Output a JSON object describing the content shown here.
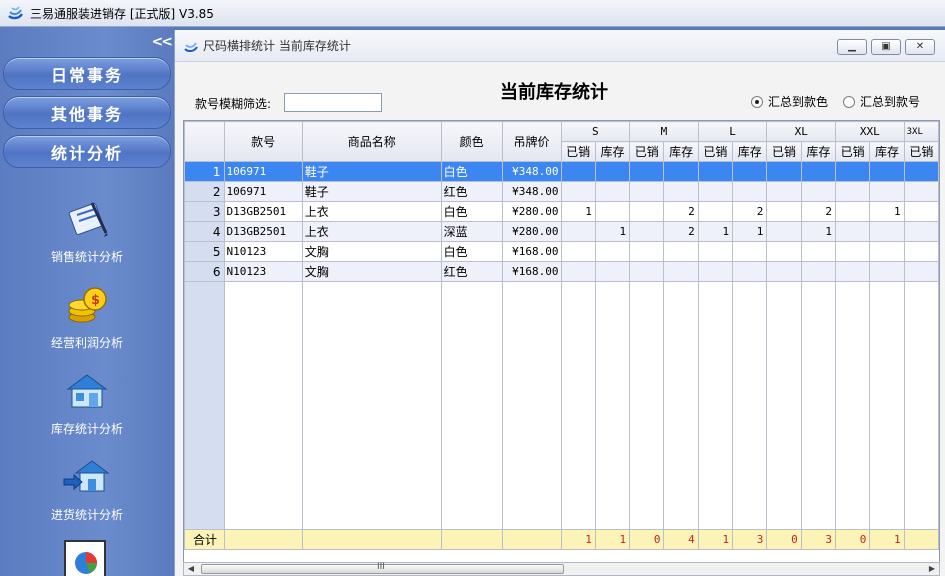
{
  "app": {
    "title": "三易通服装进销存 [正式版] V3.85"
  },
  "sidebar": {
    "collapse_glyph": "<<",
    "buttons": [
      "日常事务",
      "其他事务",
      "统计分析"
    ],
    "items": [
      {
        "label": "销售统计分析",
        "icon": "sales-chart-icon"
      },
      {
        "label": "经营利润分析",
        "icon": "coins-icon"
      },
      {
        "label": "库存统计分析",
        "icon": "warehouse-icon"
      },
      {
        "label": "进货统计分析",
        "icon": "purchase-house-icon"
      }
    ]
  },
  "window": {
    "title": "尺码横排统计 当前库存统计",
    "report_title": "当前库存统计",
    "filter_label": "款号模糊筛选:",
    "filter_value": "",
    "radio_style": "汇总到款色",
    "radio_code": "汇总到款号"
  },
  "grid": {
    "headers": {
      "code": "款号",
      "name": "商品名称",
      "color": "颜色",
      "price": "吊牌价"
    },
    "sizes": [
      "S",
      "M",
      "L",
      "XL",
      "XXL",
      "3XL"
    ],
    "sub_sold": "已销",
    "sub_stock": "库存",
    "rows": [
      {
        "n": "1",
        "code": "106971",
        "name": "鞋子",
        "color": "白色",
        "price": "¥348.00",
        "v": [
          "",
          "",
          "",
          "",
          "",
          "",
          "",
          "",
          "",
          "",
          ""
        ]
      },
      {
        "n": "2",
        "code": "106971",
        "name": "鞋子",
        "color": "红色",
        "price": "¥348.00",
        "v": [
          "",
          "",
          "",
          "",
          "",
          "",
          "",
          "",
          "",
          "",
          ""
        ]
      },
      {
        "n": "3",
        "code": "D13GB2501",
        "name": "上衣",
        "color": "白色",
        "price": "¥280.00",
        "v": [
          "1",
          "",
          "",
          "2",
          "",
          "2",
          "",
          "2",
          "",
          "1",
          ""
        ]
      },
      {
        "n": "4",
        "code": "D13GB2501",
        "name": "上衣",
        "color": "深蓝",
        "price": "¥280.00",
        "v": [
          "",
          "1",
          "",
          "2",
          "1",
          "1",
          "",
          "1",
          "",
          "",
          ""
        ]
      },
      {
        "n": "5",
        "code": "N10123",
        "name": "文胸",
        "color": "白色",
        "price": "¥168.00",
        "v": [
          "",
          "",
          "",
          "",
          "",
          "",
          "",
          "",
          "",
          "",
          ""
        ]
      },
      {
        "n": "6",
        "code": "N10123",
        "name": "文胸",
        "color": "红色",
        "price": "¥168.00",
        "v": [
          "",
          "",
          "",
          "",
          "",
          "",
          "",
          "",
          "",
          "",
          ""
        ]
      }
    ],
    "total_label": "合计",
    "totals": [
      "1",
      "1",
      "0",
      "4",
      "1",
      "3",
      "0",
      "3",
      "0",
      "1",
      ""
    ]
  },
  "scrollbar": {
    "thumb_grip": "III"
  },
  "colors": {
    "selected_row": "#3b86f0",
    "total_row": "#fbf4b6",
    "total_text": "#c0262c"
  }
}
